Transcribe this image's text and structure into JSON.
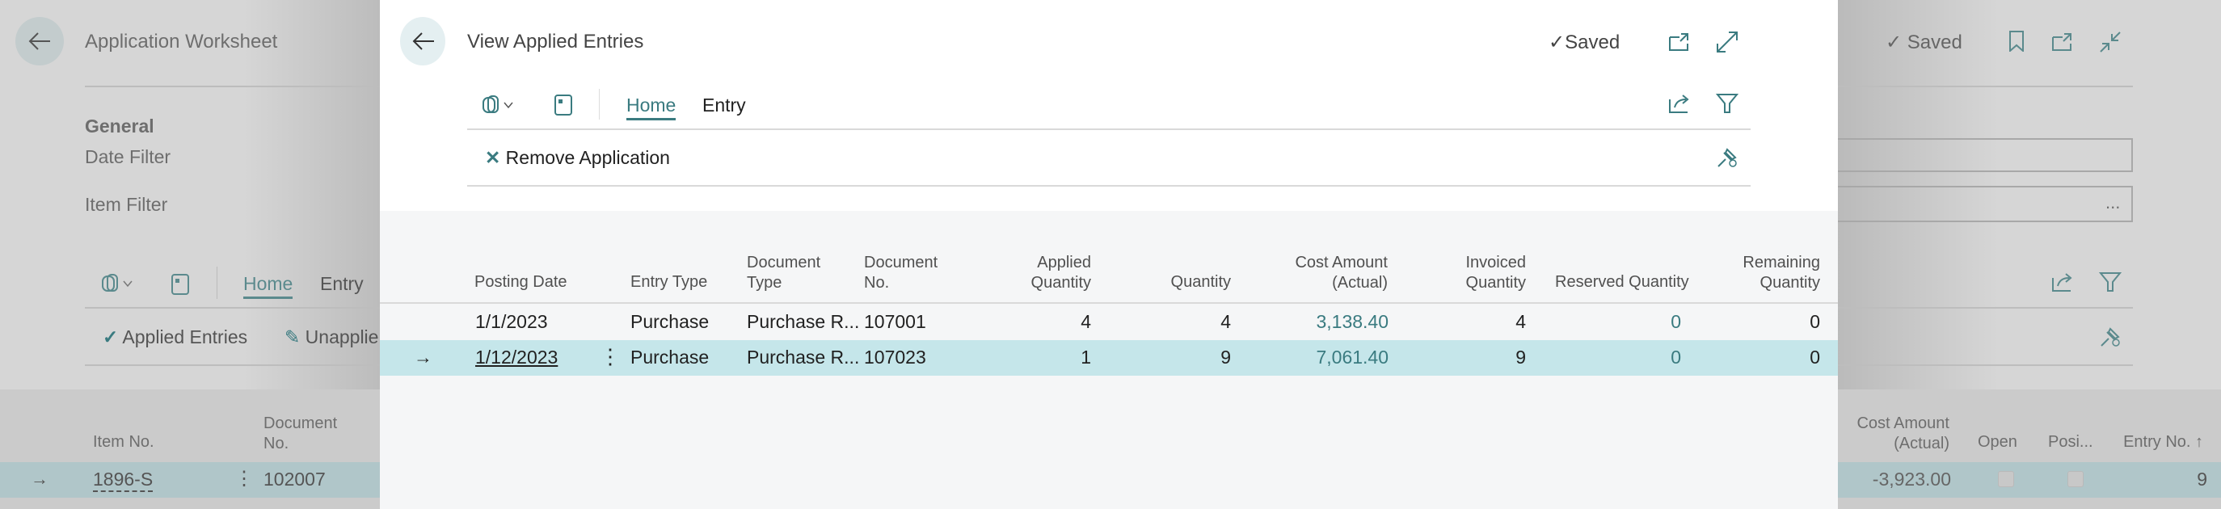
{
  "background": {
    "title": "Application Worksheet",
    "saved_label": "Saved",
    "general_heading": "General",
    "date_filter_label": "Date Filter",
    "item_filter_label": "Item Filter",
    "item_filter_button": "...",
    "tabs": [
      "Home",
      "Entry"
    ],
    "actions": [
      "Applied Entries",
      "Unapplie"
    ],
    "columns": [
      "Item No.",
      "Document No.",
      "Cost Amount (Actual)",
      "Open",
      "Posi...",
      "Entry No. ↑"
    ],
    "row": {
      "item_no": "1896-S",
      "document_no": "102007",
      "cost_amount": "-3,923.00",
      "open": false,
      "positive": false,
      "entry_no": "9"
    }
  },
  "dialog": {
    "title": "View Applied Entries",
    "saved_label": "Saved",
    "tabs": [
      "Home",
      "Entry"
    ],
    "action_remove": "Remove Application",
    "columns": {
      "posting_date": "Posting Date",
      "entry_type": "Entry Type",
      "document_type": [
        "Document",
        "Type"
      ],
      "document_no": [
        "Document",
        "No."
      ],
      "applied_quantity": [
        "Applied",
        "Quantity"
      ],
      "quantity": "Quantity",
      "cost_amount": [
        "Cost Amount",
        "(Actual)"
      ],
      "invoiced_quantity": [
        "Invoiced",
        "Quantity"
      ],
      "reserved_quantity": "Reserved Quantity",
      "remaining_quantity": [
        "Remaining",
        "Quantity"
      ]
    },
    "rows": [
      {
        "posting_date": "1/1/2023",
        "entry_type": "Purchase",
        "document_type": "Purchase R...",
        "document_no": "107001",
        "applied_quantity": "4",
        "quantity": "4",
        "cost_amount": "3,138.40",
        "invoiced_quantity": "4",
        "reserved_quantity": "0",
        "remaining_quantity": "0"
      },
      {
        "posting_date": "1/12/2023",
        "entry_type": "Purchase",
        "document_type": "Purchase R...",
        "document_no": "107023",
        "applied_quantity": "1",
        "quantity": "9",
        "cost_amount": "7,061.40",
        "invoiced_quantity": "9",
        "reserved_quantity": "0",
        "remaining_quantity": "0"
      }
    ]
  },
  "colors": {
    "accent": "#3a7b80",
    "selected_row": "#c5e6ea"
  }
}
